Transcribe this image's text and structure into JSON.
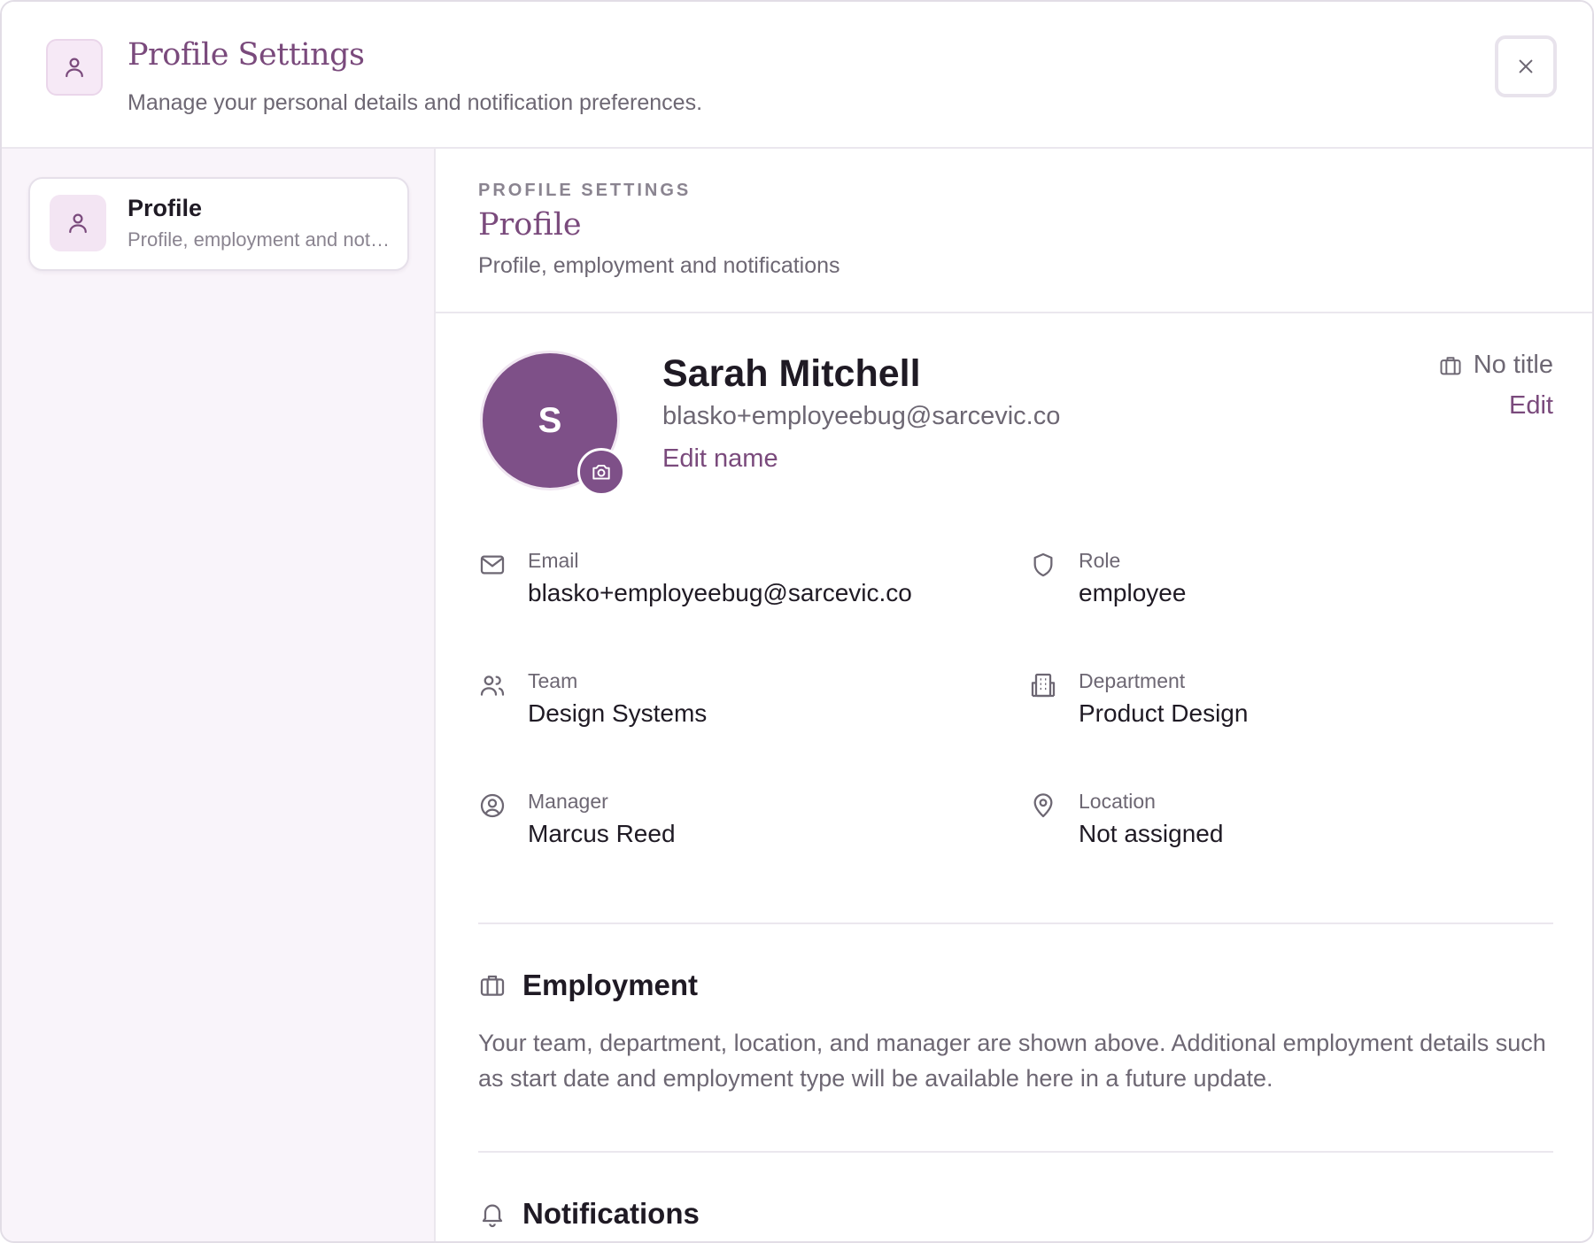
{
  "header": {
    "title": "Profile Settings",
    "subtitle": "Manage your personal details and notification preferences.",
    "close_icon": "×"
  },
  "sidebar": {
    "items": [
      {
        "label": "Profile",
        "description": "Profile, employment and notifications"
      }
    ]
  },
  "section": {
    "eyebrow": "PROFILE SETTINGS",
    "title": "Profile",
    "description": "Profile, employment and notifications"
  },
  "profile": {
    "initial": "S",
    "name": "Sarah Mitchell",
    "email": "blasko+employeebug@sarcevic.co",
    "edit_name_label": "Edit name",
    "job_title": "No title",
    "edit_title_label": "Edit"
  },
  "info": {
    "email": {
      "label": "Email",
      "value": "blasko+employeebug@sarcevic.co"
    },
    "role": {
      "label": "Role",
      "value": "employee"
    },
    "team": {
      "label": "Team",
      "value": "Design Systems"
    },
    "department": {
      "label": "Department",
      "value": "Product Design"
    },
    "manager": {
      "label": "Manager",
      "value": "Marcus Reed"
    },
    "location": {
      "label": "Location",
      "value": "Not assigned"
    }
  },
  "employment": {
    "title": "Employment",
    "text": "Your team, department, location, and manager are shown above. Additional employment details such as start date and employment type will be available here in a future update."
  },
  "notifications": {
    "title": "Notifications"
  },
  "colors": {
    "accent": "#7a4a7c",
    "avatar": "#7e5088",
    "sidebar_bg": "#f9f4fa",
    "icon_bg": "#f6e9f6"
  }
}
